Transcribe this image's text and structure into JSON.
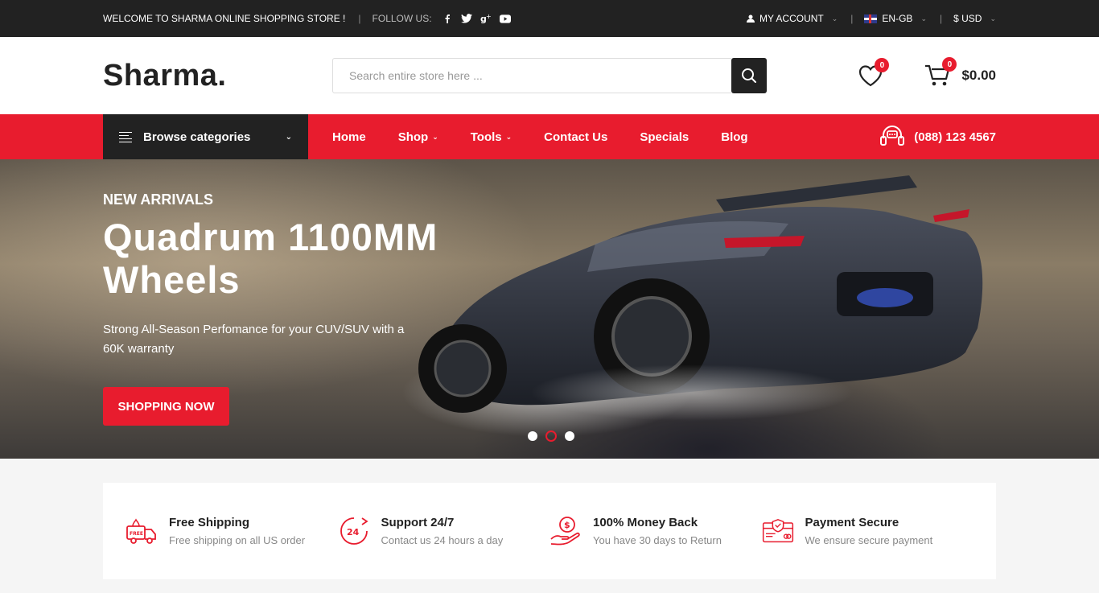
{
  "topbar": {
    "welcome": "WELCOME TO SHARMA ONLINE SHOPPING STORE !",
    "follow_label": "FOLLOW US:",
    "social_icons": [
      "facebook-icon",
      "twitter-icon",
      "google-plus-icon",
      "youtube-icon"
    ],
    "account_label": "MY ACCOUNT",
    "language_label": "EN-GB",
    "currency_label": "$ USD"
  },
  "header": {
    "logo": "Sharma.",
    "search_placeholder": "Search entire store here ...",
    "wishlist_count": "0",
    "cart_count": "0",
    "cart_total": "$0.00"
  },
  "nav": {
    "browse_label": "Browse categories",
    "items": [
      {
        "label": "Home"
      },
      {
        "label": "Shop"
      },
      {
        "label": "Tools"
      },
      {
        "label": "Contact Us"
      },
      {
        "label": "Specials"
      },
      {
        "label": "Blog"
      }
    ],
    "phone": "(088) 123 4567"
  },
  "hero": {
    "tag": "NEW ARRIVALS",
    "title": "Quadrum 1100MM Wheels",
    "description": "Strong All-Season Perfomance for your CUV/SUV with a 60K warranty",
    "button_label": "SHOPPING NOW",
    "slide_count": 3,
    "active_slide": 2
  },
  "features": [
    {
      "icon": "free-shipping-truck-icon",
      "title": "Free Shipping",
      "text": "Free shipping on all US order"
    },
    {
      "icon": "support-24-7-icon",
      "title": "Support 24/7",
      "text": "Contact us 24 hours a day"
    },
    {
      "icon": "money-back-icon",
      "title": "100% Money Back",
      "text": "You have 30 days to Return"
    },
    {
      "icon": "payment-secure-icon",
      "title": "Payment Secure",
      "text": "We ensure secure payment"
    }
  ],
  "colors": {
    "accent": "#e81c2e",
    "dark": "#222222"
  }
}
